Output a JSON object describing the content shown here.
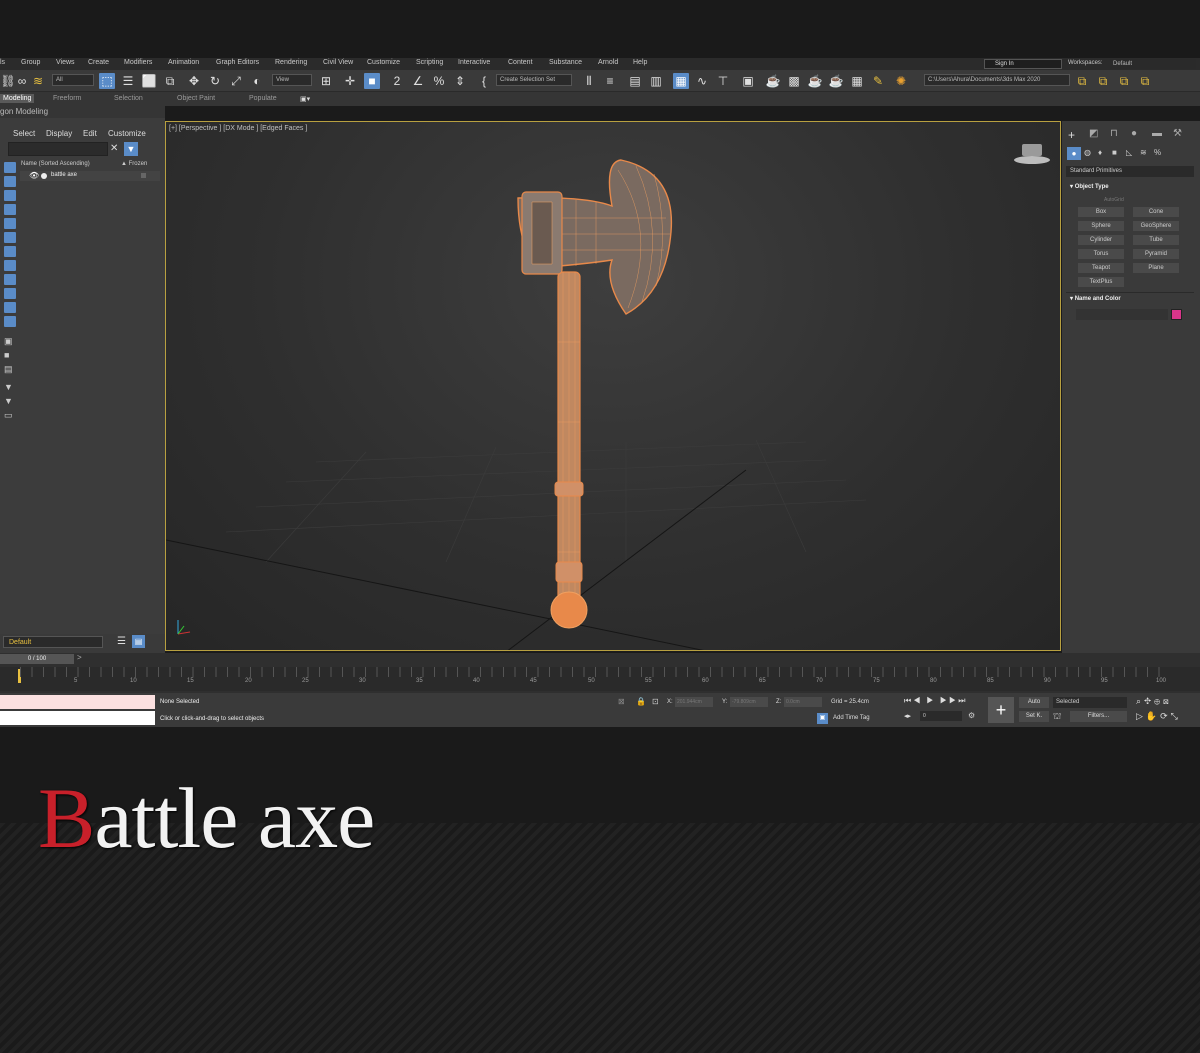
{
  "menu": [
    "ls",
    "Group",
    "Views",
    "Create",
    "Modifiers",
    "Animation",
    "Graph Editors",
    "Rendering",
    "Civil View",
    "Customize",
    "Scripting",
    "Interactive",
    "Content",
    "Substance",
    "Arnold",
    "Help"
  ],
  "signin": "Sign In",
  "workspaces_label": "Workspaces:",
  "workspaces_value": "Default",
  "toolbar": {
    "filter_all": "All",
    "view": "View",
    "selection_set": "Create Selection Set",
    "path": "C:\\Users\\Ahura\\Documents\\3ds Max 2020"
  },
  "ribbon": [
    "Modeling",
    "Freeform",
    "Selection",
    "Object Paint",
    "Populate"
  ],
  "ribbon_sub": "gon Modeling",
  "scene_explorer": {
    "menu": [
      "Select",
      "Display",
      "Edit",
      "Customize"
    ],
    "col_name": "Name (Sorted Ascending)",
    "col_frozen": "▲ Frozen",
    "item": "battle axe"
  },
  "layer": "Default",
  "viewport_label": "[+] [Perspective ] [DX Mode ] [Edged Faces ]",
  "command_panel": {
    "dropdown": "Standard Primitives",
    "object_type": "Object Type",
    "autogrid": "AutoGrid",
    "buttons": [
      "Box",
      "Cone",
      "Sphere",
      "GeoSphere",
      "Cylinder",
      "Tube",
      "Torus",
      "Pyramid",
      "Teapot",
      "Plane",
      "TextPlus"
    ],
    "name_color": "Name and Color",
    "color_swatch": "#d9358a"
  },
  "timeline": {
    "frame": "0 / 100",
    "ticks": [
      "5",
      "10",
      "15",
      "20",
      "25",
      "30",
      "35",
      "40",
      "45",
      "50",
      "55",
      "60",
      "65",
      "70",
      "75",
      "80",
      "85",
      "90",
      "95",
      "100"
    ]
  },
  "status": {
    "selection": "None Selected",
    "prompt": "Click or click-and-drag to select objects",
    "x_label": "X:",
    "x": "201.944cm",
    "y_label": "Y:",
    "y": "-79.809cm",
    "z_label": "Z:",
    "z": "0.0cm",
    "grid": "Grid = 25.4cm",
    "add_time_tag": "Add Time Tag",
    "auto": "Auto",
    "set_key": "Set K.",
    "selected": "Selected",
    "filters": "Filters...",
    "frame_field": "0"
  },
  "title": {
    "cap": "B",
    "rest": "attle axe"
  },
  "colors": {
    "accent_red": "#c8202a",
    "wire_orange": "#e8894a",
    "select_blue": "#5a8cc8"
  }
}
